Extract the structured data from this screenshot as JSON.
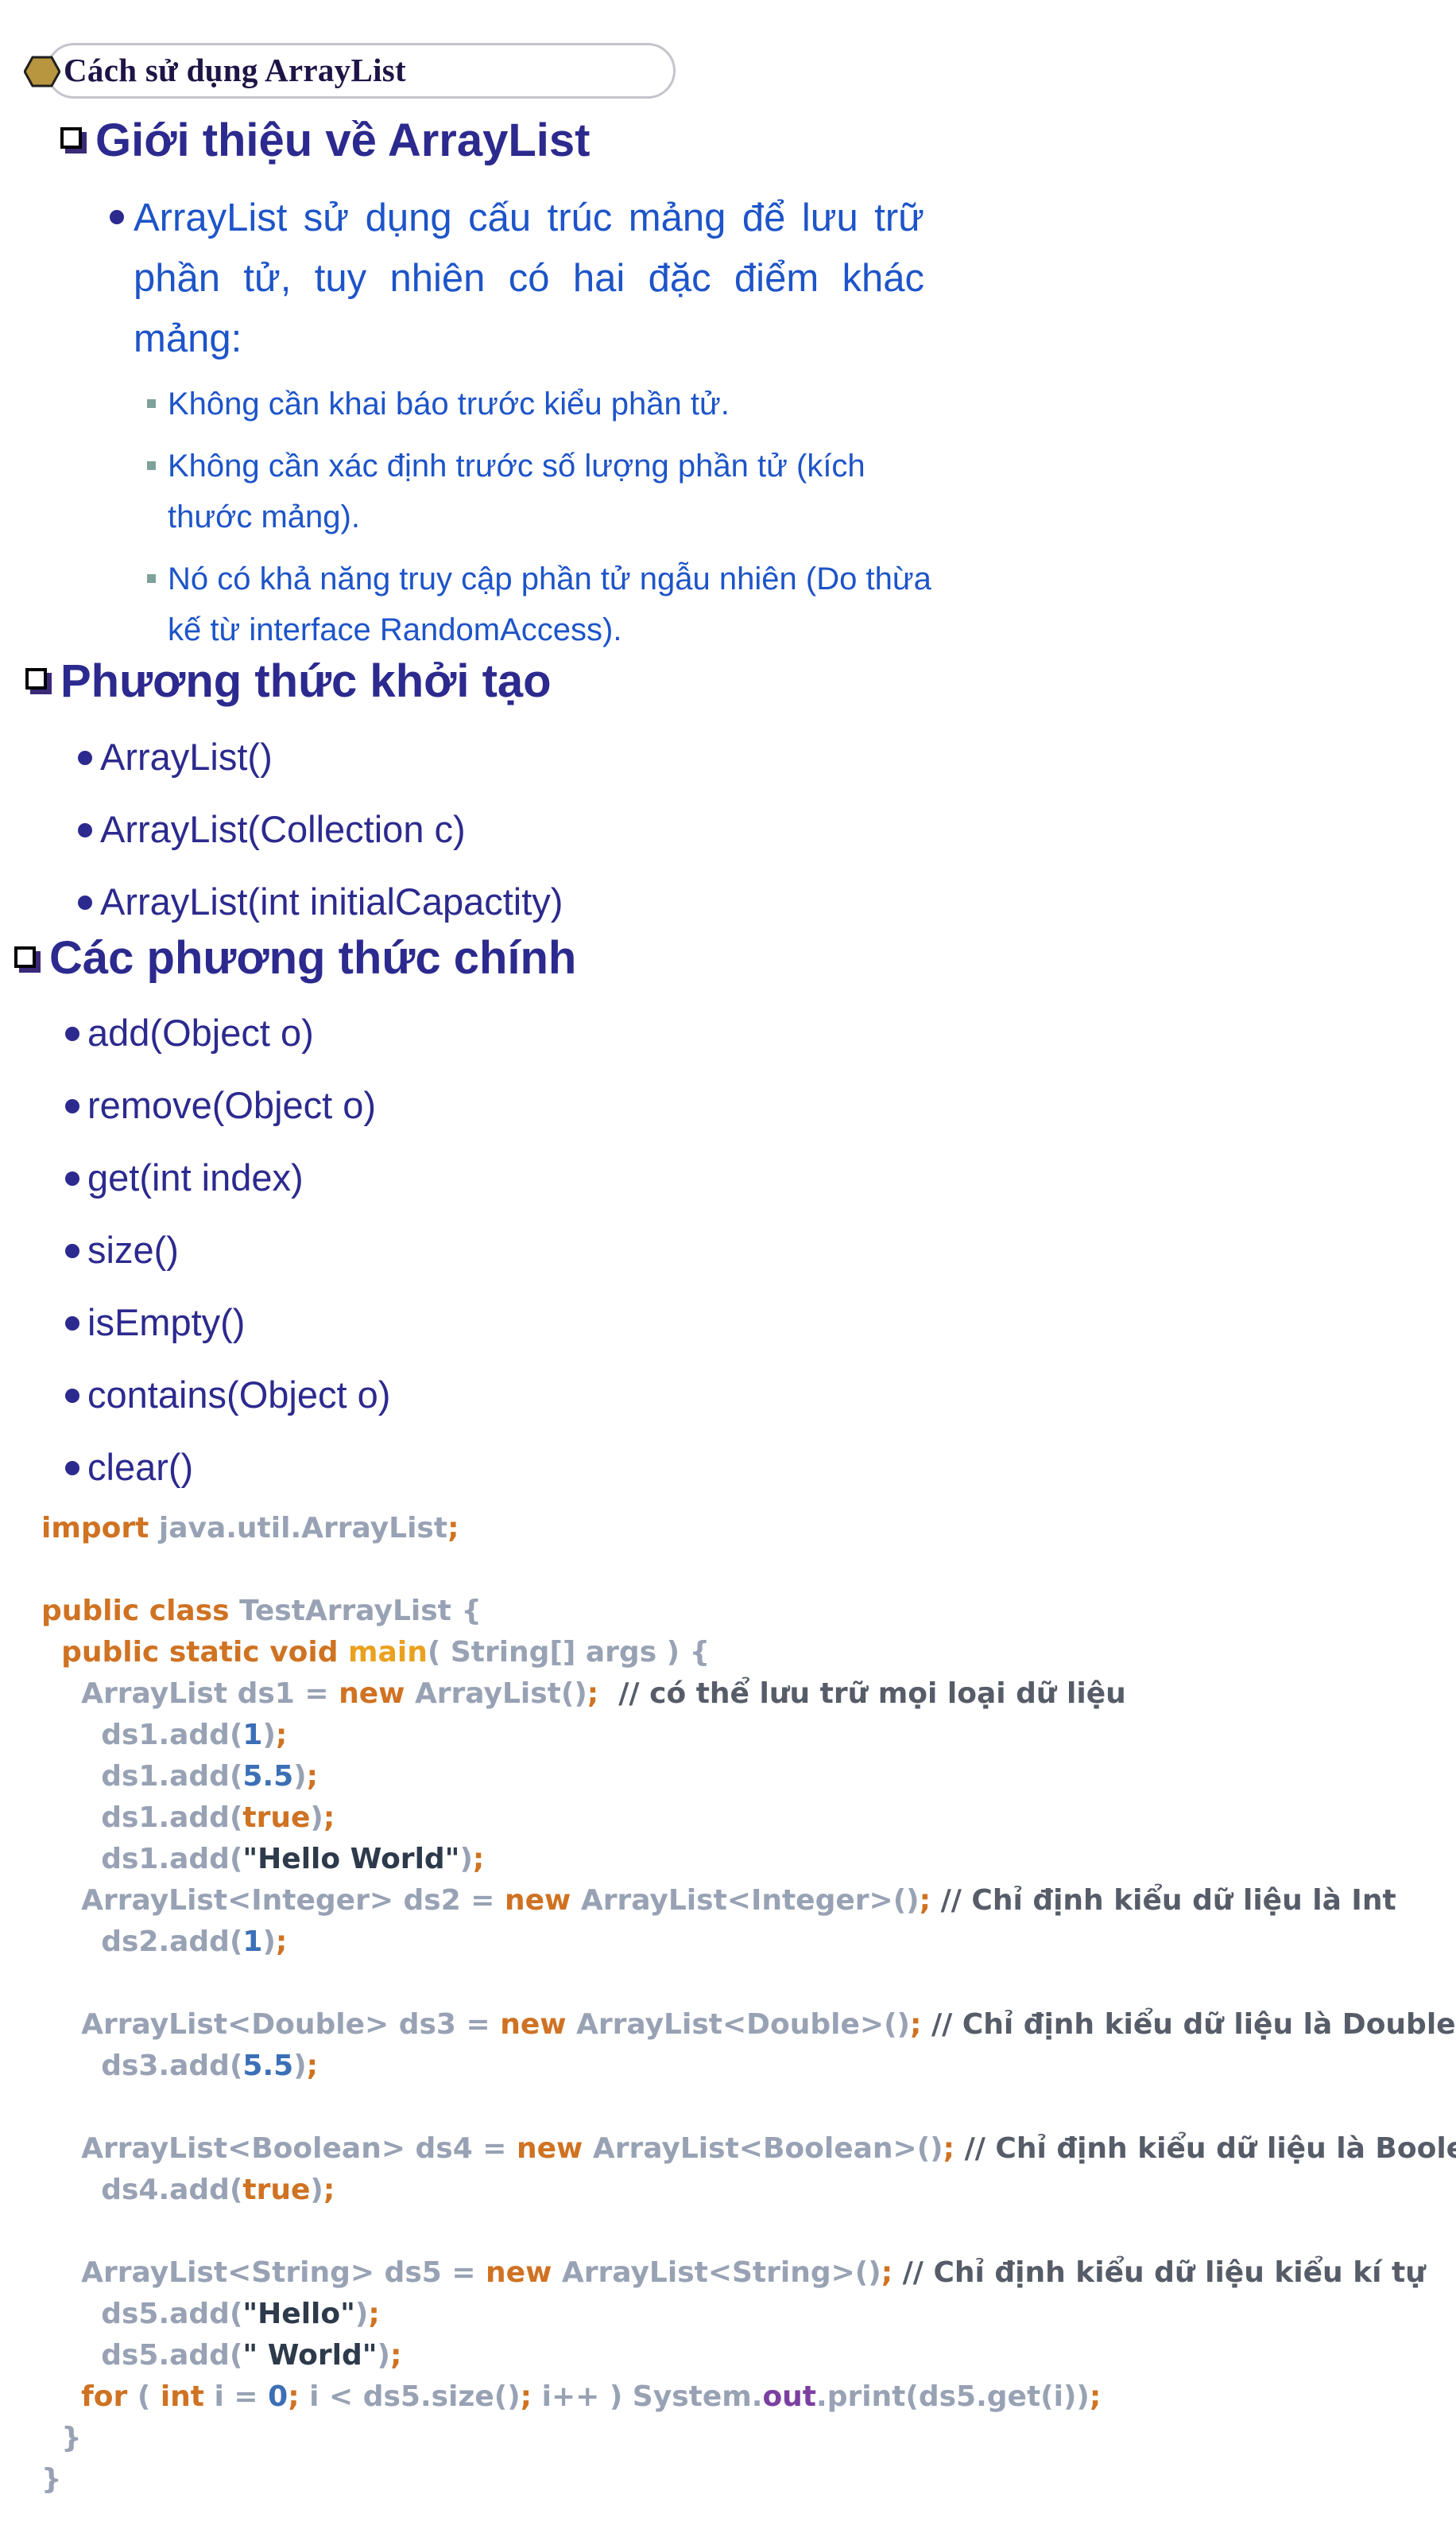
{
  "header": {
    "title": "Cách sử dụng ArrayList"
  },
  "intro_section": {
    "heading": "Giới thiệu về ArrayList",
    "paragraph": "ArrayList sử dụng cấu trúc mảng để lưu trữ phần tử, tuy nhiên có hai đặc điểm khác mảng:",
    "points": [
      "Không cần khai báo trước kiểu phần tử.",
      "Không cần xác định trước số lượng phần tử (kích thước mảng).",
      "Nó có khả năng truy cập phần tử ngẫu nhiên (Do thừa kế từ interface RandomAccess)."
    ]
  },
  "constructors_section": {
    "heading": "Phương thức khởi tạo",
    "items": [
      "ArrayList()",
      "ArrayList(Collection c)",
      "ArrayList(int initialCapactity)"
    ]
  },
  "methods_section": {
    "heading": "Các phương thức chính",
    "items": [
      "add(Object o)",
      "remove(Object o)",
      "get(int index)",
      "size()",
      "isEmpty()",
      "contains(Object o)",
      "clear()"
    ]
  },
  "code": {
    "lines": [
      "import java.util.ArrayList;",
      "",
      "public class TestArrayList {",
      "  public static void main( String[] args ) {",
      "    ArrayList ds1 = new ArrayList();  // có thể lưu trữ mọi loại dữ liệu",
      "      ds1.add(1);",
      "      ds1.add(5.5);",
      "      ds1.add(true);",
      "      ds1.add(\"Hello World\");",
      "    ArrayList<Integer> ds2 = new ArrayList<Integer>(); // Chỉ định kiểu dữ liệu là Int",
      "      ds2.add(1);",
      "",
      "    ArrayList<Double> ds3 = new ArrayList<Double>(); // Chỉ định kiểu dữ liệu là Double",
      "      ds3.add(5.5);",
      "",
      "    ArrayList<Boolean> ds4 = new ArrayList<Boolean>(); // Chỉ định kiểu dữ liệu là Boolean",
      "      ds4.add(true);",
      "",
      "    ArrayList<String> ds5 = new ArrayList<String>(); // Chỉ định kiểu dữ liệu kiểu kí tự",
      "      ds5.add(\"Hello\");",
      "      ds5.add(\" World\");",
      "    for ( int i = 0; i < ds5.size(); i++ ) System.out.print(ds5.get(i));",
      "  }",
      "}"
    ],
    "colors": {
      "keyword": "#cf7222",
      "number": "#3b6fb6",
      "string": "#2d3a4b",
      "comment": "#565c68",
      "method_name": "#e9a11f",
      "field": "#7b3fa0",
      "plain": "#98a2b4"
    }
  },
  "colors": {
    "heading": "#2c2a8e",
    "body_text": "#1d54c8",
    "title_text": "#1f1446",
    "hexagon": "#b8953f"
  }
}
